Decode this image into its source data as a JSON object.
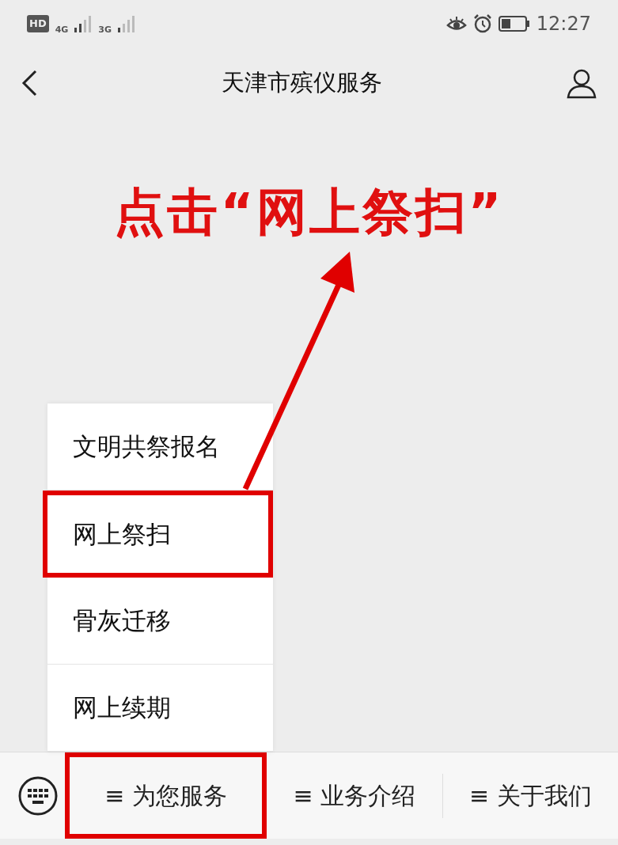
{
  "status_bar": {
    "hd": "HD",
    "network_1": "4G",
    "network_2": "3G",
    "time": "12:27"
  },
  "header": {
    "title": "天津市殡仪服务"
  },
  "annotation": {
    "text": "点击“网上祭扫”"
  },
  "menu": {
    "items": [
      {
        "label": "文明共祭报名",
        "highlighted": false
      },
      {
        "label": "网上祭扫",
        "highlighted": true
      },
      {
        "label": "骨灰迁移",
        "highlighted": false
      },
      {
        "label": "网上续期",
        "highlighted": false
      }
    ]
  },
  "bottom_bar": {
    "tabs": [
      {
        "glyph": "≡",
        "label": "为您服务",
        "highlighted": true
      },
      {
        "glyph": "≡",
        "label": "业务介绍",
        "highlighted": false
      },
      {
        "glyph": "≡",
        "label": "关于我们",
        "highlighted": false
      }
    ]
  }
}
